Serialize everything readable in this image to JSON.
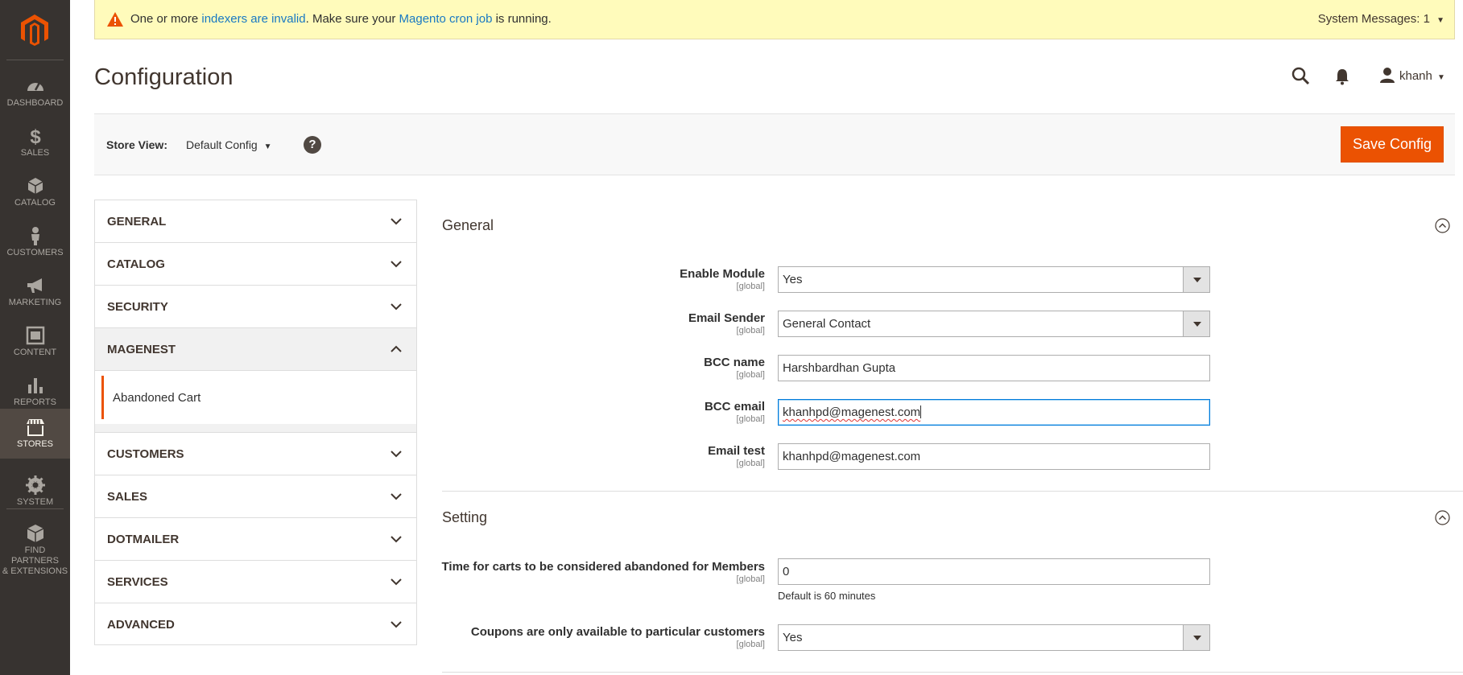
{
  "menu": {
    "items": [
      {
        "label": "DASHBOARD",
        "icon": "dashboard-icon"
      },
      {
        "label": "SALES",
        "icon": "dollar-icon"
      },
      {
        "label": "CATALOG",
        "icon": "box-icon"
      },
      {
        "label": "CUSTOMERS",
        "icon": "person-icon"
      },
      {
        "label": "MARKETING",
        "icon": "megaphone-icon"
      },
      {
        "label": "CONTENT",
        "icon": "layout-icon"
      },
      {
        "label": "REPORTS",
        "icon": "bar-chart-icon"
      },
      {
        "label": "STORES",
        "icon": "storefront-icon"
      },
      {
        "label": "SYSTEM",
        "icon": "gear-icon"
      },
      {
        "label_1": "FIND PARTNERS",
        "label_2": "& EXTENSIONS",
        "icon": "extensions-icon"
      }
    ],
    "active": "STORES"
  },
  "notice": {
    "prefix": "One or more ",
    "link1": "indexers are invalid",
    "middle": ". Make sure your ",
    "link2": "Magento cron job",
    "suffix": " is running.",
    "system_messages": "System Messages: 1"
  },
  "header": {
    "title": "Configuration",
    "username": "khanh"
  },
  "scope": {
    "label": "Store View:",
    "value": "Default Config",
    "help": "?",
    "save_label": "Save Config"
  },
  "tabs": {
    "general": "GENERAL",
    "catalog": "CATALOG",
    "security": "SECURITY",
    "magenest": "MAGENEST",
    "abandoned_cart": "Abandoned Cart",
    "customers": "CUSTOMERS",
    "sales": "SALES",
    "dotmailer": "DOTMAILER",
    "services": "SERVICES",
    "advanced": "ADVANCED"
  },
  "general_section": {
    "title": "General",
    "scope_tag": "[global]",
    "enable_module": {
      "label": "Enable Module",
      "value": "Yes"
    },
    "email_sender": {
      "label": "Email Sender",
      "value": "General Contact"
    },
    "bcc_name": {
      "label": "BCC name",
      "value": "Harshbardhan Gupta"
    },
    "bcc_email": {
      "label": "BCC email",
      "value": "khanhpd@magenest.com"
    },
    "email_test": {
      "label": "Email test",
      "value": "khanhpd@magenest.com"
    }
  },
  "setting_section": {
    "title": "Setting",
    "scope_tag": "[global]",
    "abandon_time": {
      "label": "Time for carts to be considered abandoned for Members",
      "value": "0",
      "note": "Default is 60 minutes"
    },
    "coupons": {
      "label": "Coupons are only available to particular customers",
      "value": "Yes"
    }
  },
  "colors": {
    "menu_bg": "#373330",
    "menu_active": "#514943",
    "accent": "#eb5202",
    "link": "#1979c3",
    "notice_bg": "#fffbbb"
  }
}
